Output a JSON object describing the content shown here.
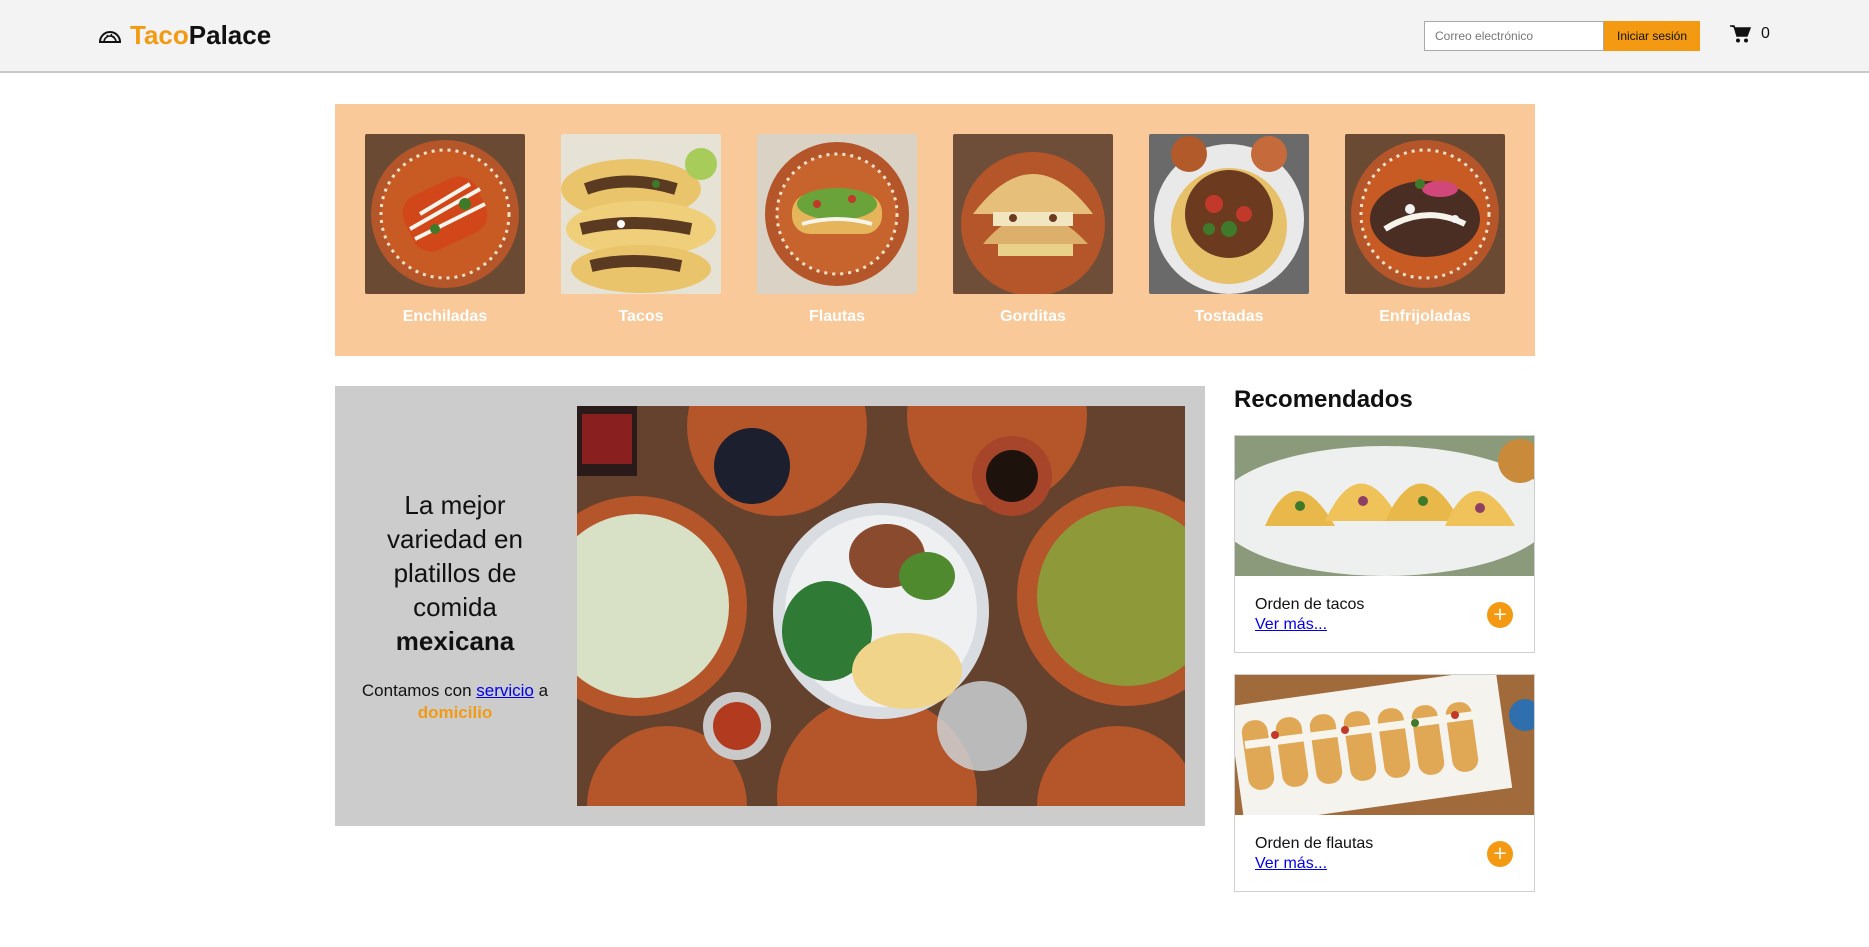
{
  "header": {
    "brand_part1": "Taco",
    "brand_part2": "Palace",
    "email_placeholder": "Correo electrónico",
    "login_label": "Iniciar sesión",
    "cart_count": "0",
    "brand_icon": "taco-icon",
    "cart_icon": "cart-icon"
  },
  "categories": [
    {
      "label": "Enchiladas"
    },
    {
      "label": "Tacos"
    },
    {
      "label": "Flautas"
    },
    {
      "label": "Gorditas"
    },
    {
      "label": "Tostadas"
    },
    {
      "label": "Enfrijoladas"
    }
  ],
  "hero": {
    "title_line1": "La mejor",
    "title_line2": "variedad en",
    "title_line3": "platillos de",
    "title_line4": "comida",
    "title_bold": "mexicana",
    "sub_prefix": "Contamos con",
    "sub_link": "servicio",
    "sub_mid": "a",
    "sub_orange": "domicilio"
  },
  "recommended": {
    "title": "Recomendados",
    "items": [
      {
        "name": "Orden de tacos",
        "more": "Ver más...",
        "add": "+"
      },
      {
        "name": "Orden de flautas",
        "more": "Ver más...",
        "add": "+"
      }
    ]
  },
  "colors": {
    "accent": "#f39a12",
    "category_bg": "#f9c99a",
    "hero_bg": "#cccccc",
    "header_bg": "#f3f3f3"
  }
}
